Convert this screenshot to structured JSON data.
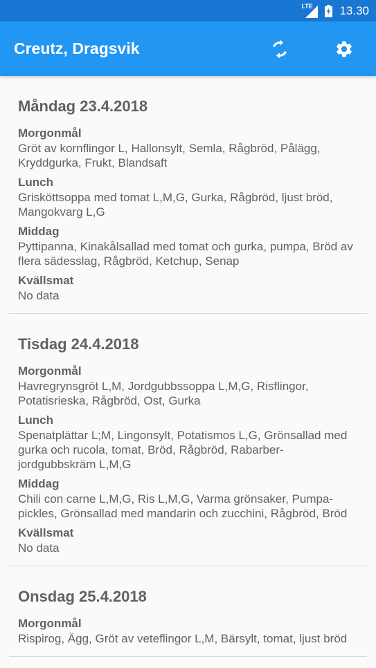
{
  "status_bar": {
    "network": "LTE",
    "time": "13.30"
  },
  "app_bar": {
    "title": "Creutz, Dragsvik",
    "refresh_icon": "refresh-icon",
    "settings_icon": "gear-icon",
    "color": "#2196f3"
  },
  "days": [
    {
      "title": "Måndag 23.4.2018",
      "meals": [
        {
          "label": "Morgonmål",
          "text": "Gröt av kornflingor L, Hallonsylt, Semla, Rågbröd, Pålägg, Kryddgurka, Frukt, Blandsaft"
        },
        {
          "label": "Lunch",
          "text": "Grisköttsoppa med tomat L,M,G, Gurka, Rågbröd, ljust bröd, Mangokvarg L,G"
        },
        {
          "label": "Middag",
          "text": "Pyttipanna, Kinakålsallad med tomat och gurka, pumpa, Bröd av flera sädesslag, Rågbröd, Ketchup, Senap"
        },
        {
          "label": "Kvällsmat",
          "text": "No data"
        }
      ]
    },
    {
      "title": "Tisdag 24.4.2018",
      "meals": [
        {
          "label": "Morgonmål",
          "text": "Havregrynsgröt L,M, Jordgubbssoppa L,M,G, Risflingor, Potatisrieska, Rågbröd, Ost, Gurka"
        },
        {
          "label": "Lunch",
          "text": "Spenatplättar L;M, Lingonsylt, Potatismos L,G, Grönsallad med gurka och rucola, tomat, Bröd, Rågbröd, Rabarber-jordgubbskräm L,M,G"
        },
        {
          "label": "Middag",
          "text": "Chili con carne L,M,G, Ris L,M,G, Varma grönsaker, Pumpa-pickles, Grönsallad med mandarin och zucchini, Rågbröd, Bröd"
        },
        {
          "label": "Kvällsmat",
          "text": "No data"
        }
      ]
    },
    {
      "title": "Onsdag 25.4.2018",
      "meals": [
        {
          "label": "Morgonmål",
          "text": "Rispirog, Ägg, Gröt av veteflingor L,M, Bärsylt, tomat, ljust bröd"
        }
      ]
    }
  ]
}
